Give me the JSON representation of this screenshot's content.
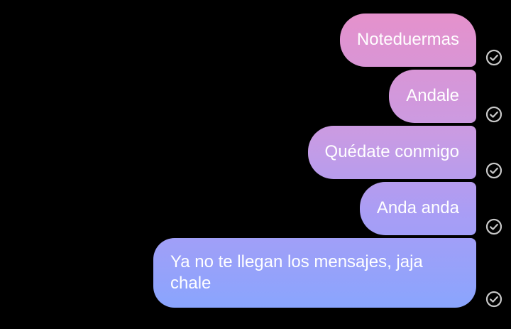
{
  "messages": [
    {
      "text": "Noteduermas",
      "status_icon": "check-circle-icon"
    },
    {
      "text": "Andale",
      "status_icon": "check-circle-icon"
    },
    {
      "text": "Quédate conmigo",
      "status_icon": "check-circle-icon"
    },
    {
      "text": "Anda anda",
      "status_icon": "check-circle-icon"
    },
    {
      "text": "Ya no te llegan los mensajes, jaja chale",
      "status_icon": "check-circle-icon"
    }
  ],
  "colors": {
    "background": "#000000",
    "bubble_top": "#e890c9",
    "bubble_bottom": "#88a5fe",
    "text": "#ffffff",
    "check": "#c8c8c8"
  }
}
